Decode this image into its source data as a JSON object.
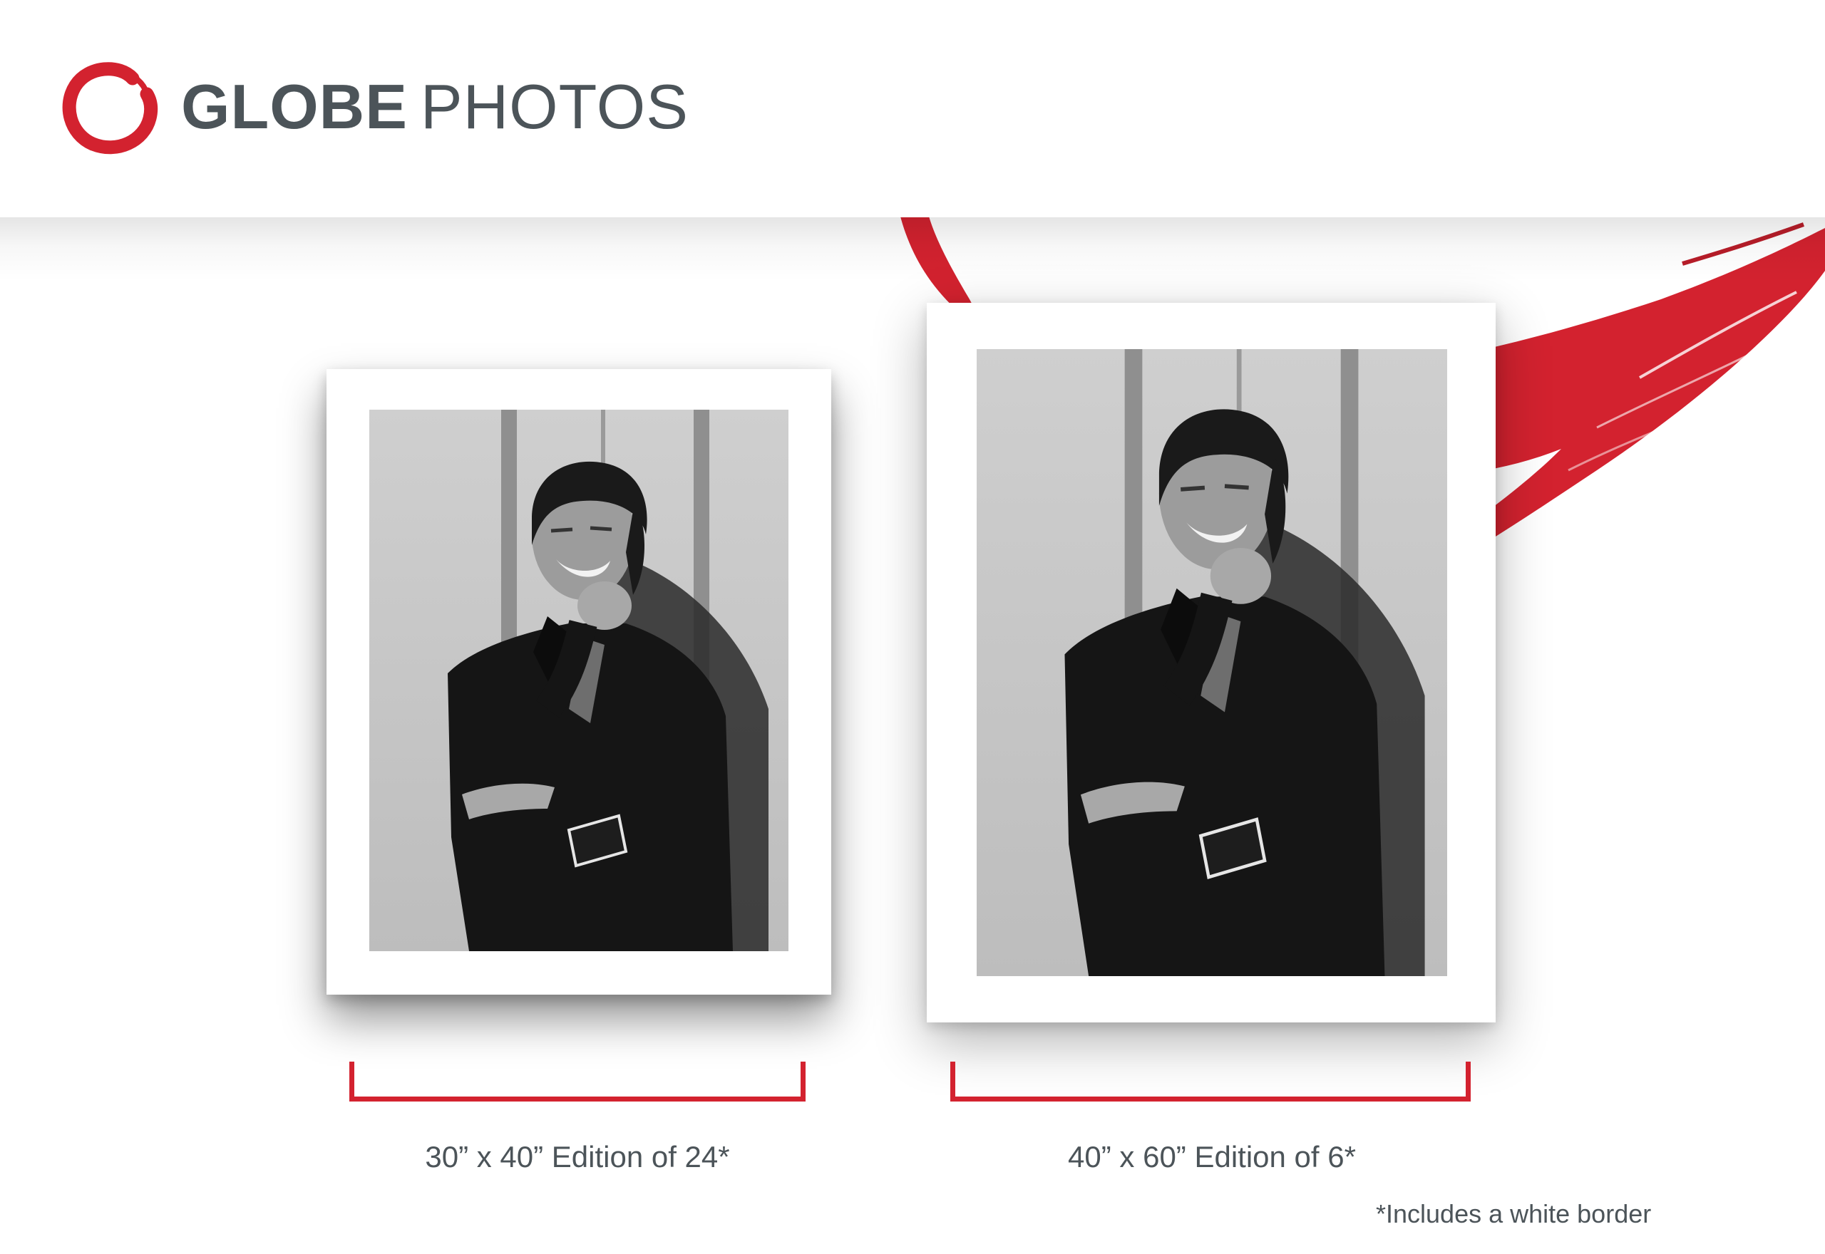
{
  "brand": {
    "name_bold": "GLOBE",
    "name_light": "PHOTOS",
    "accent_color": "#d3222f",
    "text_color": "#4c5459",
    "logo_icon": "brush-circle-icon"
  },
  "prints": [
    {
      "caption": "30” x 40” Edition of 24*",
      "photo_subject": "black-and-white-portrait"
    },
    {
      "caption": "40” x 60” Edition of 6*",
      "photo_subject": "black-and-white-portrait"
    }
  ],
  "footnote": "*Includes a white border"
}
